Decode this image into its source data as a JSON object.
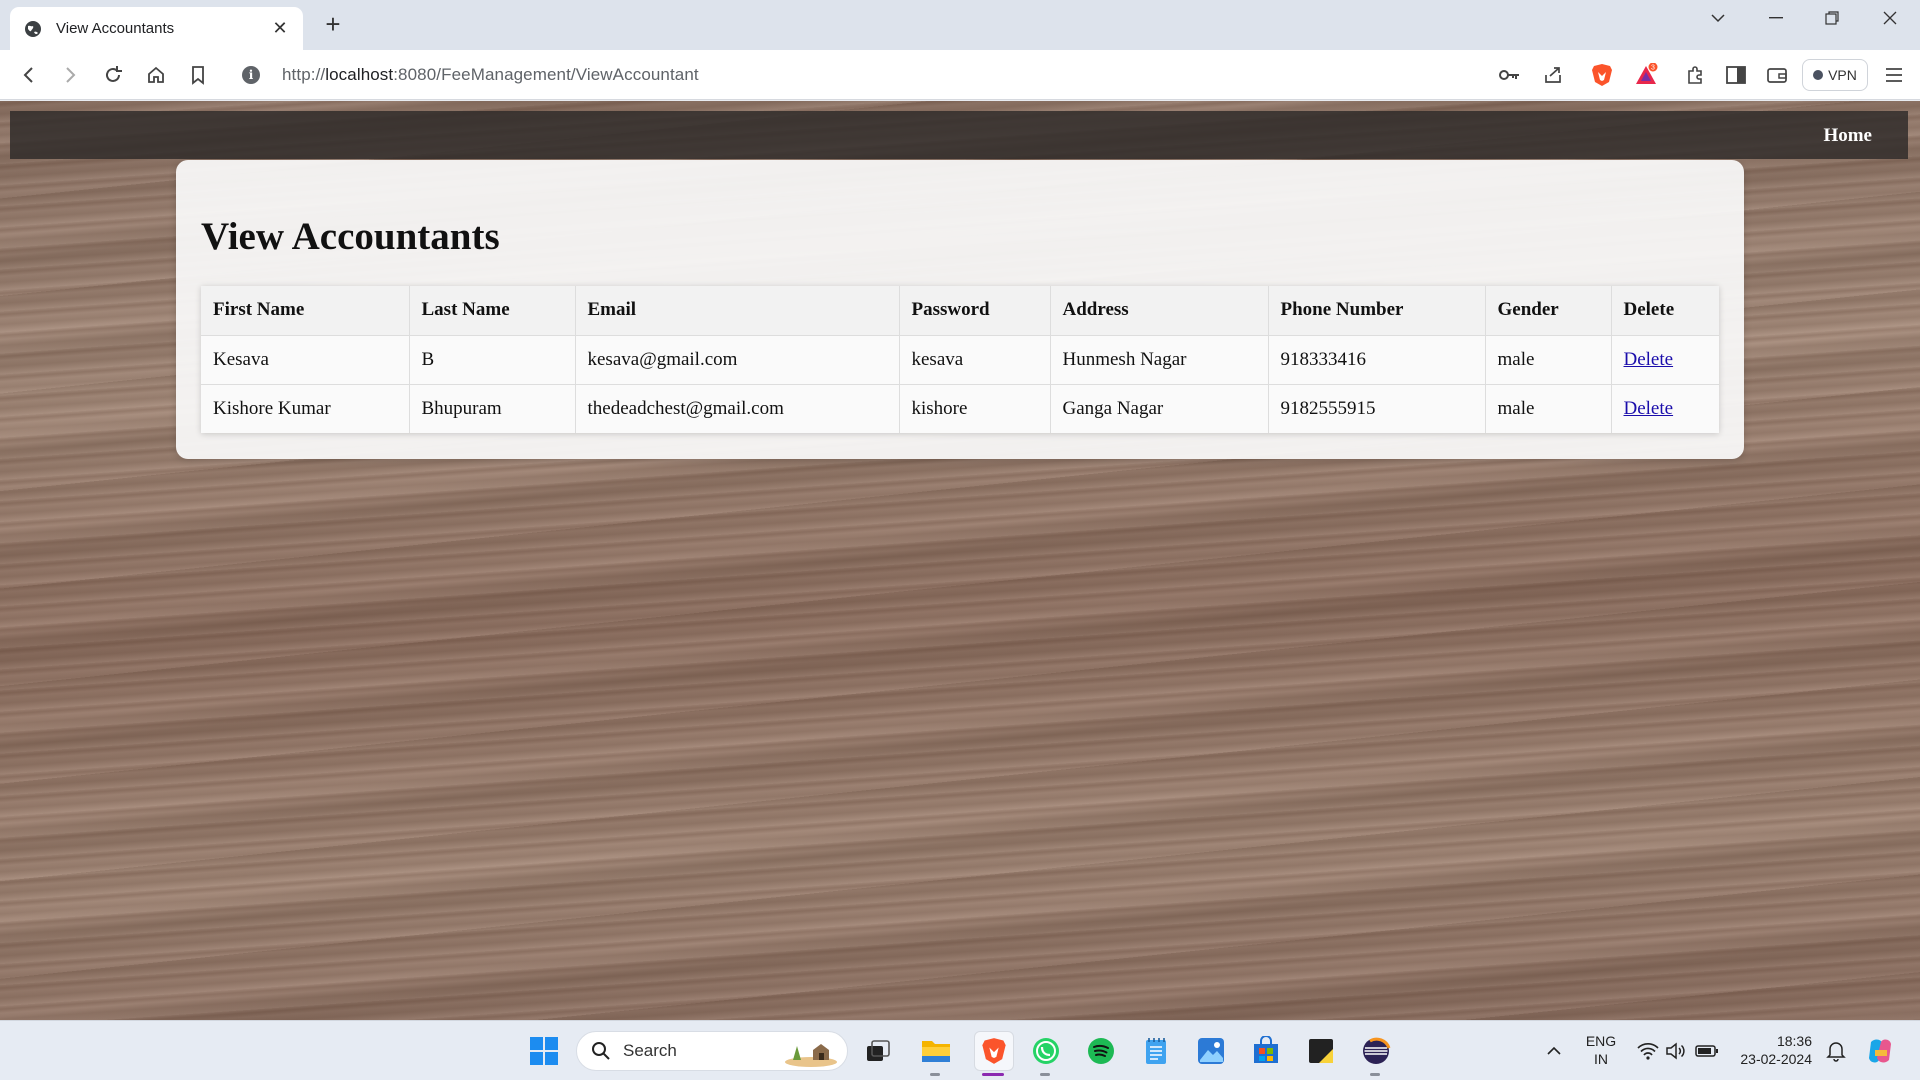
{
  "browser": {
    "tab_title": "View Accountants",
    "url_prefix": "http://",
    "url_host": "localhost",
    "url_rest": ":8080/FeeManagement/ViewAccountant",
    "vpn_label": "VPN",
    "notification_badge": "3"
  },
  "navbar": {
    "home_link": "Home"
  },
  "page": {
    "heading": "View Accountants",
    "columns": [
      "First Name",
      "Last Name",
      "Email",
      "Password",
      "Address",
      "Phone Number",
      "Gender",
      "Delete"
    ],
    "rows": [
      {
        "first_name": "Kesava",
        "last_name": "B",
        "email": "kesava@gmail.com",
        "password": "kesava",
        "address": "Hunmesh Nagar",
        "phone": "918333416",
        "gender": "male",
        "delete": "Delete"
      },
      {
        "first_name": "Kishore Kumar",
        "last_name": "Bhupuram",
        "email": "thedeadchest@gmail.com",
        "password": "kishore",
        "address": "Ganga Nagar",
        "phone": "9182555915",
        "gender": "male",
        "delete": "Delete"
      }
    ]
  },
  "taskbar": {
    "search_label": "Search",
    "lang_line1": "ENG",
    "lang_line2": "IN",
    "time": "18:36",
    "date": "23-02-2024"
  },
  "colors": {
    "link": "#1a0dab",
    "navbar_bg": "#2d2a28",
    "brave_orange": "#fb542b"
  }
}
